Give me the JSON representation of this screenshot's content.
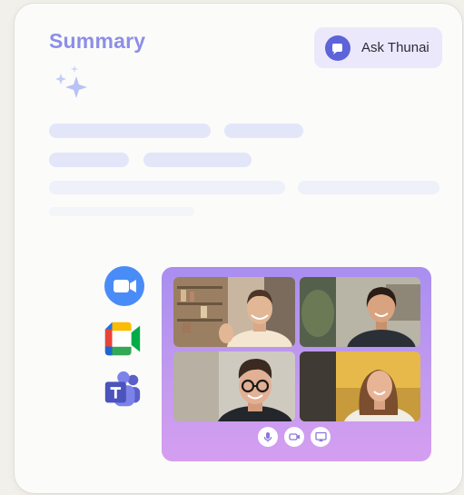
{
  "summary": {
    "title": "Summary"
  },
  "ask_button": {
    "label": "Ask Thunai",
    "icon": "chat-bubble-icon"
  },
  "apps": [
    {
      "name": "Zoom",
      "icon": "zoom-icon"
    },
    {
      "name": "Google Meet",
      "icon": "google-meet-icon"
    },
    {
      "name": "Microsoft Teams",
      "icon": "teams-icon"
    }
  ],
  "call_controls": [
    {
      "icon": "microphone-icon"
    },
    {
      "icon": "video-camera-icon"
    },
    {
      "icon": "screen-share-icon"
    }
  ],
  "colors": {
    "title": "#8d8ee8",
    "ask_button_bg": "#ece8fb",
    "ask_icon": "#5d63d8",
    "skeleton": "#e3e6f9",
    "call_panel_top": "#a98ef0",
    "call_panel_bottom": "#d59ef0"
  }
}
